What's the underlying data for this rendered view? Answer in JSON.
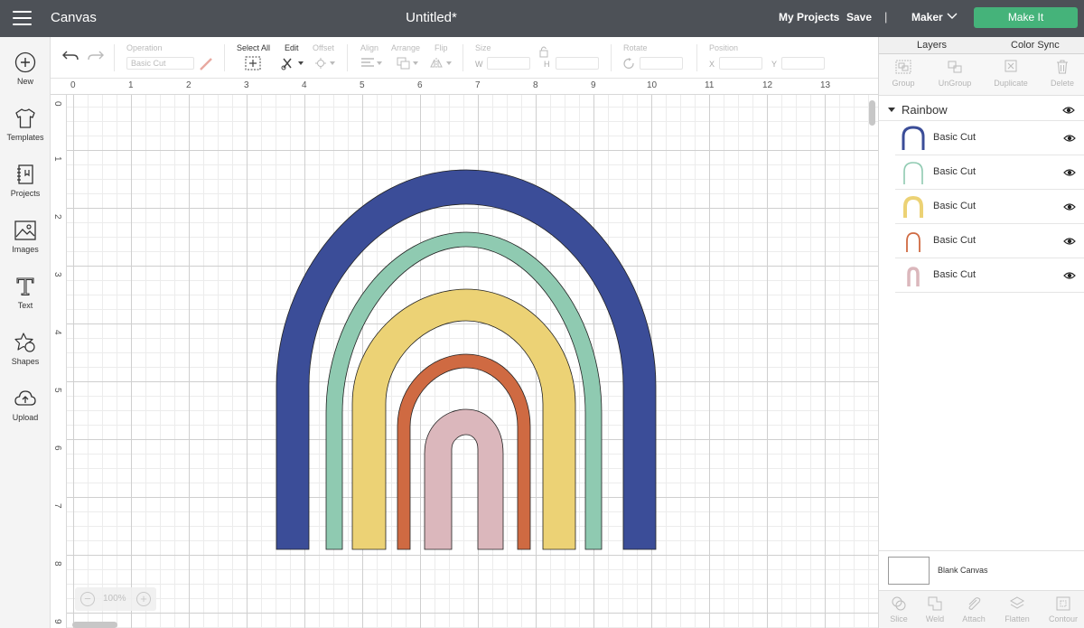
{
  "topbar": {
    "app_title": "Canvas",
    "document_title": "Untitled*",
    "my_projects": "My Projects",
    "save": "Save",
    "separator": "|",
    "machine": "Maker",
    "make_it": "Make It",
    "make_it_color": "#45b37a"
  },
  "leftnav": {
    "items": [
      {
        "label": "New",
        "icon": "plus-circle-icon"
      },
      {
        "label": "Templates",
        "icon": "tshirt-icon"
      },
      {
        "label": "Projects",
        "icon": "projects-icon"
      },
      {
        "label": "Images",
        "icon": "image-icon"
      },
      {
        "label": "Text",
        "icon": "text-icon"
      },
      {
        "label": "Shapes",
        "icon": "shapes-icon"
      },
      {
        "label": "Upload",
        "icon": "cloud-upload-icon"
      }
    ]
  },
  "toolbar": {
    "operation_label": "Operation",
    "operation_value": "Basic Cut",
    "select_all": "Select All",
    "edit": "Edit",
    "offset": "Offset",
    "align": "Align",
    "arrange": "Arrange",
    "flip": "Flip",
    "size": "Size",
    "w": "W",
    "h": "H",
    "rotate": "Rotate",
    "position": "Position",
    "x": "X",
    "y": "Y"
  },
  "rulers": {
    "horizontal": [
      "0",
      "1",
      "2",
      "3",
      "4",
      "5",
      "6",
      "7",
      "8",
      "9",
      "10",
      "11",
      "12",
      "13"
    ],
    "vertical": [
      "0",
      "1",
      "2",
      "3",
      "4",
      "5",
      "6",
      "7",
      "8",
      "9"
    ]
  },
  "zoom": {
    "minus": "−",
    "value": "100%",
    "plus": "+"
  },
  "panel": {
    "tabs": [
      "Layers",
      "Color Sync"
    ],
    "actions": [
      "Group",
      "UnGroup",
      "Duplicate",
      "Delete"
    ],
    "group_name": "Rainbow",
    "layers": [
      {
        "name": "Basic Cut",
        "color": "#3b4d98"
      },
      {
        "name": "Basic Cut",
        "color": "#8fcab1"
      },
      {
        "name": "Basic Cut",
        "color": "#ecd275"
      },
      {
        "name": "Basic Cut",
        "color": "#cf6a42"
      },
      {
        "name": "Basic Cut",
        "color": "#dbb7bc"
      }
    ],
    "blank_canvas": "Blank Canvas",
    "bottom_actions": [
      "Slice",
      "Weld",
      "Attach",
      "Flatten",
      "Contour"
    ]
  }
}
